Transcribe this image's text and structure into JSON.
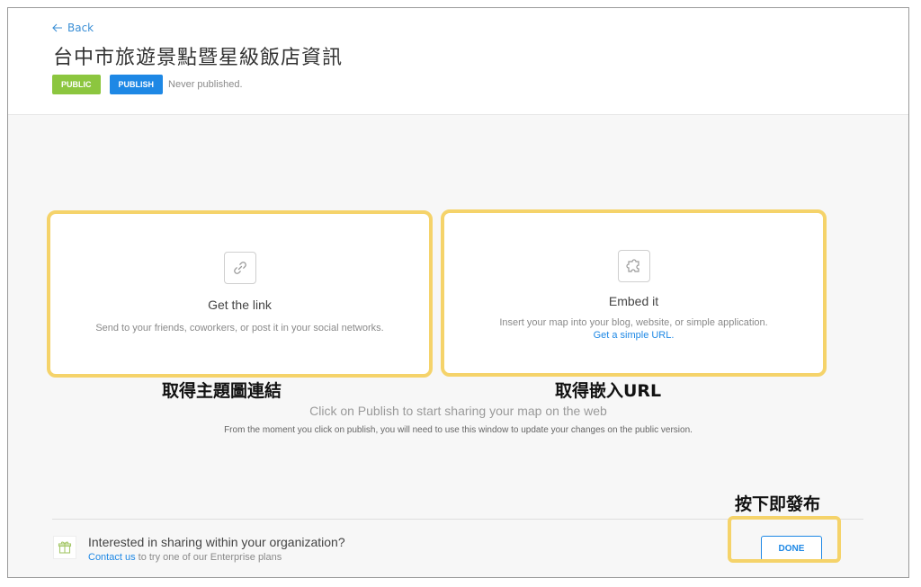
{
  "header": {
    "back_label": "Back",
    "title": "台中市旅遊景點暨星級飯店資訊",
    "badge_public": "PUBLIC",
    "badge_publish": "PUBLISH",
    "status": "Never published."
  },
  "cards": {
    "link": {
      "icon": "link-icon",
      "title": "Get the link",
      "description": "Send to your friends, coworkers, or post it in your social networks."
    },
    "embed": {
      "icon": "puzzle-icon",
      "title": "Embed it",
      "description": "Insert your map into your blog, website, or simple application.",
      "link_label": "Get a simple URL."
    }
  },
  "annotations": {
    "link": "取得主題圖連結",
    "embed": "取得嵌入URL",
    "done": "按下即發布"
  },
  "main": {
    "cta": "Click on Publish to start sharing your map on the web",
    "note": "From the moment you click on publish, you will need to use this window to update your changes on the public version."
  },
  "footer": {
    "icon": "gift-icon",
    "title": "Interested in sharing within your organization?",
    "contact_label": "Contact us",
    "contact_rest": " to try one of our Enterprise plans",
    "done_label": "DONE"
  },
  "colors": {
    "accent": "#1e88e5",
    "public_badge": "#8cc63f",
    "highlight": "#f5d36a"
  }
}
